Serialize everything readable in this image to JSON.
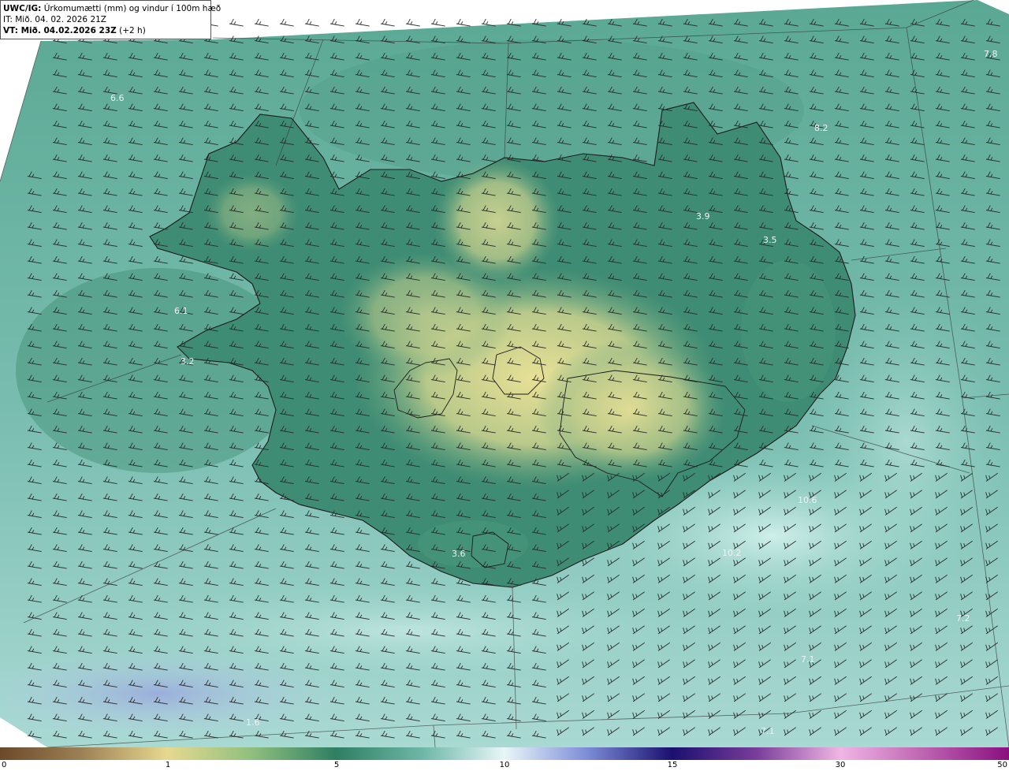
{
  "header": {
    "model": "UWC/IG:",
    "title": "Úrkomumætti (mm) og vindur í 100m hæð",
    "init_time": "IT: Mið. 04. 02. 2026 21Z",
    "valid_label": "VT: Mið. 04.02.2026 23Z",
    "valid_offset": "(+2 h)"
  },
  "colorbar": {
    "ticks": [
      "0",
      "1",
      "5",
      "10",
      "15",
      "30",
      "50"
    ]
  },
  "value_labels": [
    "7.8",
    "6.6",
    "8.2",
    "3.9",
    "3.5",
    "6.1",
    "3.2",
    "10.6",
    "3.6",
    "10.2",
    "7.2",
    "7.1",
    "7.1",
    "1.6"
  ],
  "colors": {
    "sea": "#6db5a6",
    "land_low": "#3d8a73",
    "land_high": "#d8d88c",
    "wet": "#bfe8e2"
  }
}
